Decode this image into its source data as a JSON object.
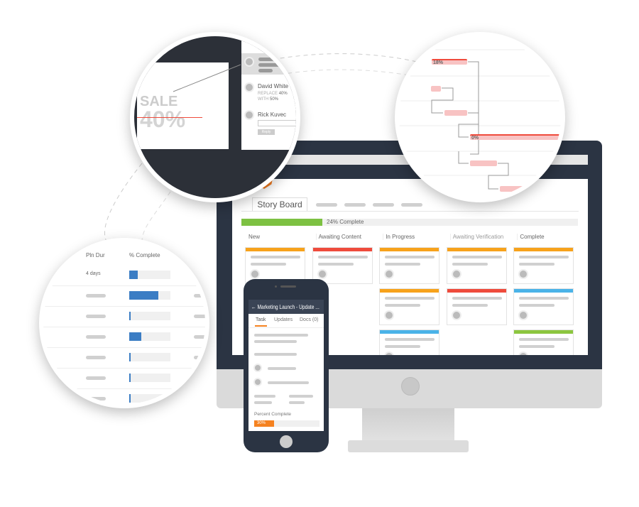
{
  "colors": {
    "orange": "#f7a21b",
    "red": "#ef4b3c",
    "blue": "#4ab3e8",
    "green": "#8cc63f",
    "navy": "#2b3443",
    "progress_green": "#7dc142",
    "phone_orange": "#f58220",
    "table_blue": "#3b7dc4"
  },
  "desktop": {
    "tab_active": "Story Board",
    "progress": {
      "value": 24,
      "label": "24% Complete"
    },
    "columns": [
      {
        "title": "New",
        "cards": [
          "orange"
        ]
      },
      {
        "title": "Awaiting Content",
        "cards": [
          "red"
        ]
      },
      {
        "title": "In Progress",
        "cards": [
          "orange",
          "orange",
          "blue"
        ]
      },
      {
        "title": "Awaiting Verification",
        "cards": [
          "orange",
          "red"
        ]
      },
      {
        "title": "Complete",
        "cards": [
          "orange",
          "blue",
          "green"
        ]
      }
    ]
  },
  "phone": {
    "title": "Marketing Launch - Update ...",
    "tabs": [
      "Task",
      "Updates",
      "Docs (0)"
    ],
    "percent_label": "Percent Complete",
    "percent": {
      "value": 30,
      "label": "30%"
    }
  },
  "comments": {
    "sale_text": "SALE",
    "sale_pct": "40%",
    "user1": "David White",
    "user1_line1_a": "REPLACE ",
    "user1_line1_b": "40%",
    "user1_line2_a": "WITH ",
    "user1_line2_b": "50%",
    "user2": "Rick Kuvec",
    "reply": "Reply"
  },
  "gantt": {
    "bar1_label": "18%",
    "bar4_label": "0%"
  },
  "table": {
    "headers": [
      "Pln Dur",
      "% Complete"
    ],
    "first_duration": "4 days",
    "percents": [
      20,
      70,
      3,
      30,
      3,
      3,
      3
    ]
  }
}
